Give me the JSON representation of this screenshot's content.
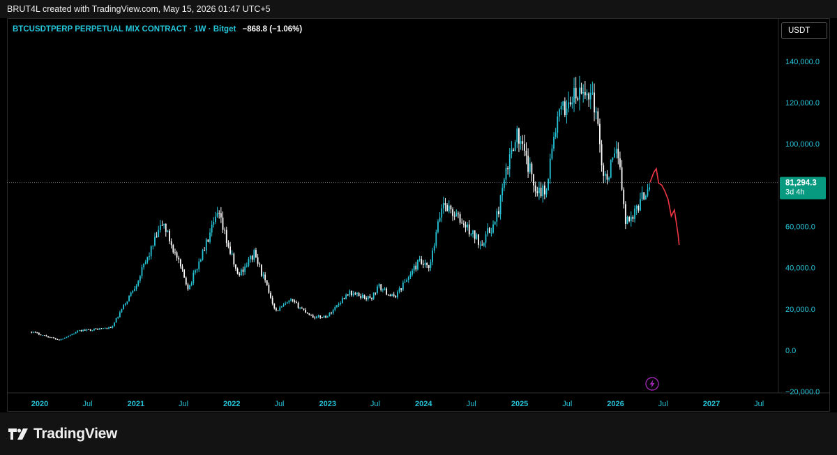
{
  "header": {
    "credit": "BRUT4L created with TradingView.com, May 15, 2026 01:47 UTC+5"
  },
  "legend": {
    "symbol": "BTCUSDTPERP PERPETUAL MIX CONTRACT · 1W · Bitget",
    "change": "−868.8 (−1.06%)"
  },
  "currency_button": "USDT",
  "price_label": {
    "price": "81,294.3",
    "countdown": "3d 4h"
  },
  "footer": {
    "brand": "TradingView"
  },
  "colors": {
    "up": "#26c6da",
    "down": "#ffffff",
    "projection": "#f23645",
    "price_badge": "#089981",
    "axis_text": "#26c6da",
    "lightning": "#9c27b0"
  },
  "icons": {
    "lightning": "lightning-icon",
    "logo": "tradingview-logo-icon"
  },
  "chart_data": {
    "type": "candlestick",
    "timeframe": "1W",
    "y_ticks": [
      "140,000.0",
      "120,000.0",
      "100,000.0",
      "60,000.0",
      "40,000.0",
      "20,000.0",
      "0.0",
      "−20,000.0"
    ],
    "y_range": [
      -20000,
      150000
    ],
    "x_tick_labels": [
      "2020",
      "Jul",
      "2021",
      "Jul",
      "2022",
      "Jul",
      "2023",
      "Jul",
      "2024",
      "Jul",
      "2025",
      "Jul",
      "2026",
      "Jul",
      "2027",
      "Jul"
    ],
    "last_price": 81294.3,
    "price_anchors": [
      {
        "date": "2019-12-01",
        "price": 9000
      },
      {
        "date": "2020-03-15",
        "price": 5000
      },
      {
        "date": "2020-06-01",
        "price": 9500
      },
      {
        "date": "2020-10-01",
        "price": 11000
      },
      {
        "date": "2021-01-01",
        "price": 32000
      },
      {
        "date": "2021-04-14",
        "price": 62000
      },
      {
        "date": "2021-07-20",
        "price": 30000
      },
      {
        "date": "2021-11-10",
        "price": 66000
      },
      {
        "date": "2022-01-24",
        "price": 36000
      },
      {
        "date": "2022-03-28",
        "price": 47000
      },
      {
        "date": "2022-06-18",
        "price": 19000
      },
      {
        "date": "2022-08-14",
        "price": 24000
      },
      {
        "date": "2022-11-09",
        "price": 16000
      },
      {
        "date": "2022-12-31",
        "price": 16500
      },
      {
        "date": "2023-03-20",
        "price": 28000
      },
      {
        "date": "2023-06-15",
        "price": 25000
      },
      {
        "date": "2023-07-13",
        "price": 31000
      },
      {
        "date": "2023-09-10",
        "price": 25500
      },
      {
        "date": "2023-12-15",
        "price": 43000
      },
      {
        "date": "2024-01-23",
        "price": 39000
      },
      {
        "date": "2024-03-14",
        "price": 72000
      },
      {
        "date": "2024-08-05",
        "price": 52000
      },
      {
        "date": "2024-10-01",
        "price": 62000
      },
      {
        "date": "2024-12-17",
        "price": 106000
      },
      {
        "date": "2025-02-28",
        "price": 80000
      },
      {
        "date": "2025-04-07",
        "price": 76000
      },
      {
        "date": "2025-05-22",
        "price": 111000
      },
      {
        "date": "2025-07-14",
        "price": 122000
      },
      {
        "date": "2025-10-06",
        "price": 125000
      },
      {
        "date": "2025-11-21",
        "price": 82000
      },
      {
        "date": "2026-01-14",
        "price": 97000
      },
      {
        "date": "2026-02-06",
        "price": 62000
      },
      {
        "date": "2026-03-15",
        "price": 67000
      },
      {
        "date": "2026-05-12",
        "price": 81294.3
      }
    ],
    "projection": [
      {
        "date": "2026-05-12",
        "price": 81294.3
      },
      {
        "date": "2026-05-26",
        "price": 86000
      },
      {
        "date": "2026-06-05",
        "price": 88000
      },
      {
        "date": "2026-06-14",
        "price": 81000
      },
      {
        "date": "2026-06-26",
        "price": 80000
      },
      {
        "date": "2026-07-08",
        "price": 77000
      },
      {
        "date": "2026-07-20",
        "price": 73000
      },
      {
        "date": "2026-08-01",
        "price": 65000
      },
      {
        "date": "2026-08-13",
        "price": 68000
      },
      {
        "date": "2026-08-27",
        "price": 56000
      },
      {
        "date": "2026-08-31",
        "price": 51000
      }
    ],
    "grid": false,
    "legend": "top-left"
  }
}
